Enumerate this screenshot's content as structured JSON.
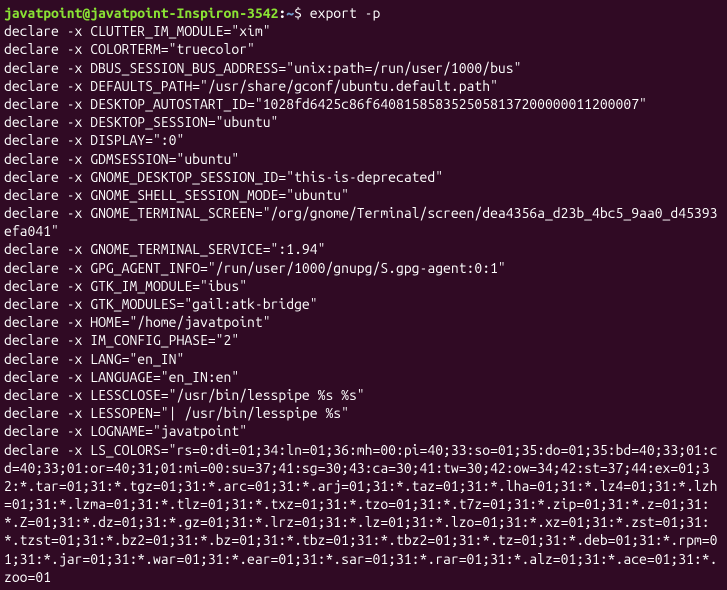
{
  "prompt": {
    "user_host": "javatpoint@javatpoint-Inspiron-3542",
    "separator": ":",
    "path": "~",
    "dollar": "$"
  },
  "command": "export -p",
  "output": [
    "declare -x CLUTTER_IM_MODULE=\"xim\"",
    "declare -x COLORTERM=\"truecolor\"",
    "declare -x DBUS_SESSION_BUS_ADDRESS=\"unix:path=/run/user/1000/bus\"",
    "declare -x DEFAULTS_PATH=\"/usr/share/gconf/ubuntu.default.path\"",
    "declare -x DESKTOP_AUTOSTART_ID=\"1028fd6425c86f6408158583525058137200000011200007\"",
    "declare -x DESKTOP_SESSION=\"ubuntu\"",
    "declare -x DISPLAY=\":0\"",
    "declare -x GDMSESSION=\"ubuntu\"",
    "declare -x GNOME_DESKTOP_SESSION_ID=\"this-is-deprecated\"",
    "declare -x GNOME_SHELL_SESSION_MODE=\"ubuntu\"",
    "declare -x GNOME_TERMINAL_SCREEN=\"/org/gnome/Terminal/screen/dea4356a_d23b_4bc5_9aa0_d45393efa041\"",
    "declare -x GNOME_TERMINAL_SERVICE=\":1.94\"",
    "declare -x GPG_AGENT_INFO=\"/run/user/1000/gnupg/S.gpg-agent:0:1\"",
    "declare -x GTK_IM_MODULE=\"ibus\"",
    "declare -x GTK_MODULES=\"gail:atk-bridge\"",
    "declare -x HOME=\"/home/javatpoint\"",
    "declare -x IM_CONFIG_PHASE=\"2\"",
    "declare -x LANG=\"en_IN\"",
    "declare -x LANGUAGE=\"en_IN:en\"",
    "declare -x LESSCLOSE=\"/usr/bin/lesspipe %s %s\"",
    "declare -x LESSOPEN=\"| /usr/bin/lesspipe %s\"",
    "declare -x LOGNAME=\"javatpoint\"",
    "declare -x LS_COLORS=\"rs=0:di=01;34:ln=01;36:mh=00:pi=40;33:so=01;35:do=01;35:bd=40;33;01:cd=40;33;01:or=40;31;01:mi=00:su=37;41:sg=30;43:ca=30;41:tw=30;42:ow=34;42:st=37;44:ex=01;32:*.tar=01;31:*.tgz=01;31:*.arc=01;31:*.arj=01;31:*.taz=01;31:*.lha=01;31:*.lz4=01;31:*.lzh=01;31:*.lzma=01;31:*.tlz=01;31:*.txz=01;31:*.tzo=01;31:*.t7z=01;31:*.zip=01;31:*.z=01;31:*.Z=01;31:*.dz=01;31:*.gz=01;31:*.lrz=01;31:*.lz=01;31:*.lzo=01;31:*.xz=01;31:*.zst=01;31:*.tzst=01;31:*.bz2=01;31:*.bz=01;31:*.tbz=01;31:*.tbz2=01;31:*.tz=01;31:*.deb=01;31:*.rpm=01;31:*.jar=01;31:*.war=01;31:*.ear=01;31:*.sar=01;31:*.rar=01;31:*.alz=01;31:*.ace=01;31:*.zoo=01"
  ]
}
